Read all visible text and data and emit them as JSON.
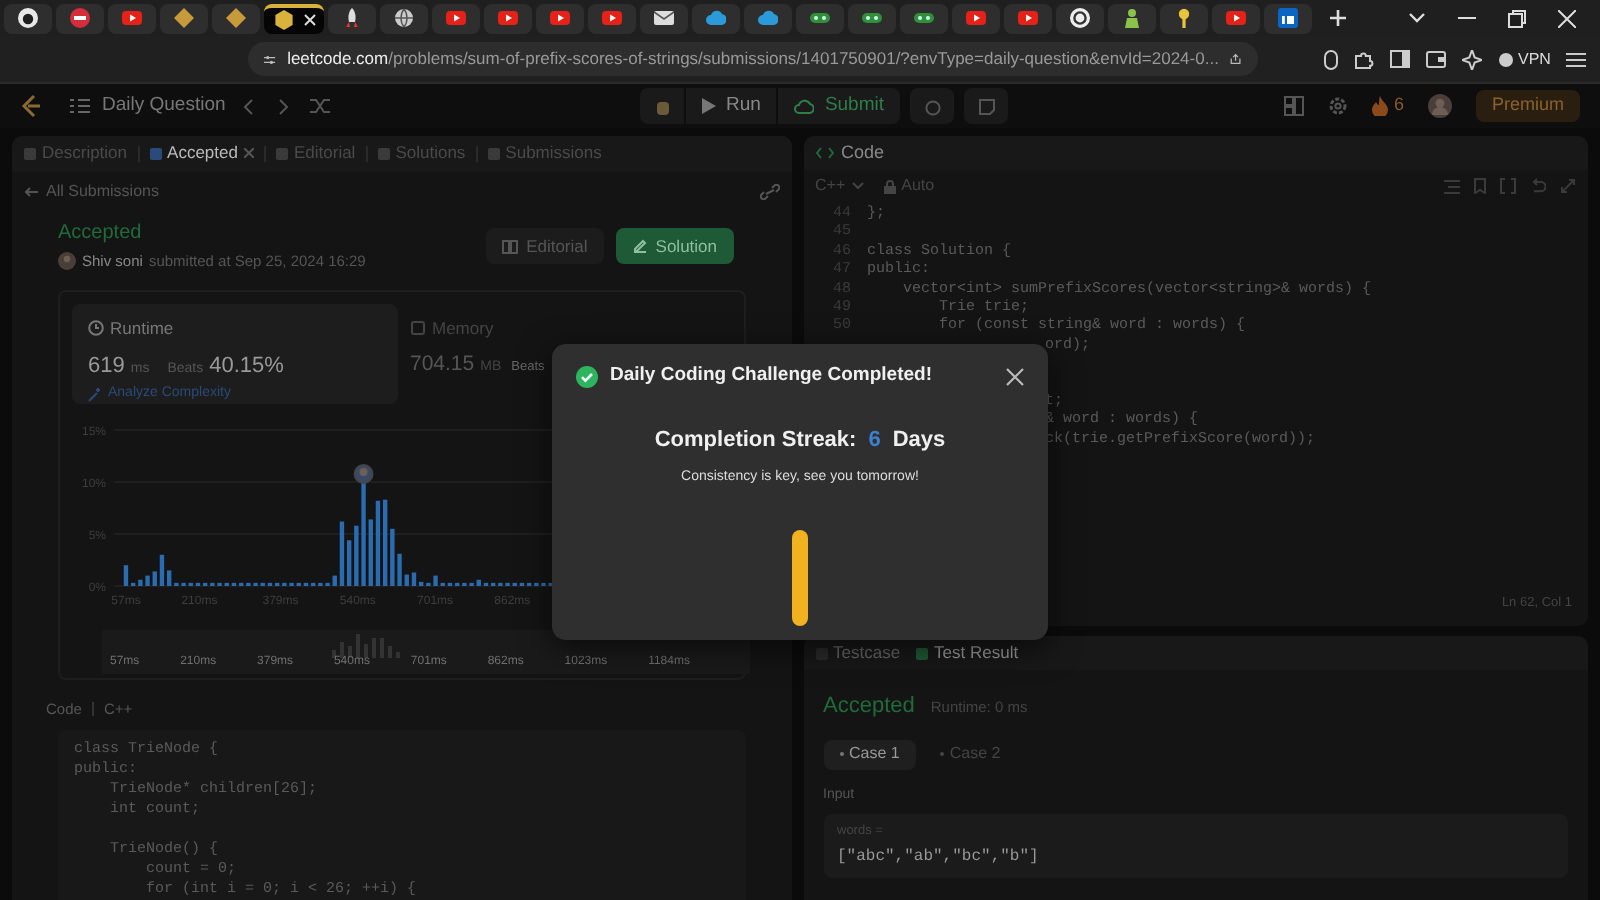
{
  "browser": {
    "tabs": [
      {
        "kind": "github",
        "selected": false
      },
      {
        "kind": "redbadge",
        "selected": false
      },
      {
        "kind": "youtube",
        "selected": false
      },
      {
        "kind": "logo",
        "selected": false
      },
      {
        "kind": "logo",
        "selected": false
      },
      {
        "kind": "letter",
        "selected": true
      },
      {
        "kind": "rocket",
        "selected": false
      },
      {
        "kind": "globe",
        "selected": false
      },
      {
        "kind": "youtube",
        "selected": false
      },
      {
        "kind": "youtube",
        "selected": false
      },
      {
        "kind": "youtube",
        "selected": false
      },
      {
        "kind": "youtube",
        "selected": false
      },
      {
        "kind": "mail",
        "selected": false
      },
      {
        "kind": "cloud",
        "selected": false
      },
      {
        "kind": "cloud",
        "selected": false
      },
      {
        "kind": "gamepad",
        "selected": false
      },
      {
        "kind": "gamepad",
        "selected": false
      },
      {
        "kind": "gamepad",
        "selected": false
      },
      {
        "kind": "youtube",
        "selected": false
      },
      {
        "kind": "youtube",
        "selected": false
      },
      {
        "kind": "circle",
        "selected": false
      },
      {
        "kind": "person",
        "selected": false
      },
      {
        "kind": "key",
        "selected": false
      },
      {
        "kind": "youtube",
        "selected": false
      },
      {
        "kind": "linkedin",
        "selected": false
      }
    ],
    "url_host": "leetcode.com",
    "url_path": "/problems/sum-of-prefix-scores-of-strings/submissions/1401750901/?envType=daily-question&envId=2024-0...",
    "vpn": "VPN"
  },
  "toolbar": {
    "title": "Daily Question",
    "run": "Run",
    "submit": "Submit",
    "streak": "6",
    "premium": "Premium"
  },
  "left_panel": {
    "tabs": [
      {
        "label": "Description",
        "selected": false,
        "closable": false
      },
      {
        "label": "Accepted",
        "selected": true,
        "closable": true
      },
      {
        "label": "Editorial",
        "selected": false,
        "closable": false
      },
      {
        "label": "Solutions",
        "selected": false,
        "closable": false
      },
      {
        "label": "Submissions",
        "selected": false,
        "closable": false
      }
    ],
    "back_link": "All Submissions",
    "status": "Accepted",
    "author": "Shiv soni",
    "submitted": "submitted at Sep 25, 2024 16:29",
    "buttons": [
      {
        "label": "Editorial",
        "kind": "plain"
      },
      {
        "label": "Solution",
        "kind": "primary"
      }
    ],
    "runtime": {
      "title": "Runtime",
      "value": "619",
      "unit": "ms",
      "beats_label": "Beats",
      "beats": "40.15%",
      "link": "Analyze Complexity"
    },
    "memory": {
      "title": "Memory",
      "value": "704.15",
      "unit": "MB",
      "beats_label": "Beats"
    },
    "chart_data": {
      "type": "bar",
      "x": [
        57,
        72,
        87,
        102,
        117,
        132,
        147,
        162,
        177,
        192,
        207,
        222,
        237,
        252,
        267,
        282,
        297,
        312,
        327,
        342,
        357,
        372,
        387,
        402,
        417,
        432,
        447,
        462,
        477,
        492,
        507,
        522,
        537,
        552,
        567,
        582,
        597,
        612,
        627,
        642,
        657,
        672,
        687,
        702,
        717,
        732,
        747,
        762,
        777,
        792,
        807,
        822,
        837,
        852,
        867,
        882,
        897,
        912,
        927,
        942
      ],
      "series": [
        {
          "color": "#2b6cb0",
          "values": [
            2.0,
            0.3,
            0.6,
            1.0,
            1.4,
            3.0,
            1.5,
            0.3,
            0.3,
            0.3,
            0.3,
            0.3,
            0.3,
            0.3,
            0.3,
            0.3,
            0.3,
            0.3,
            0.3,
            0.3,
            0.3,
            0.3,
            0.3,
            0.3,
            0.3,
            0.3,
            0.3,
            0.3,
            0.3,
            1.0,
            6.2,
            4.4,
            5.8,
            10.0,
            6.4,
            8.2,
            8.3,
            5.5,
            3.1,
            1.1,
            1.3,
            0.4,
            0.3,
            1.0,
            0.3,
            0.3,
            0.3,
            0.3,
            0.3,
            0.6,
            0.3,
            0.3,
            0.3,
            0.3,
            0.3,
            0.3,
            0.3,
            0.3,
            0.3,
            0.3
          ]
        }
      ],
      "xlim": [
        50,
        965
      ],
      "ylim": [
        0,
        15
      ],
      "yticks": [
        {
          "value": 0,
          "label": "0%"
        },
        {
          "value": 5,
          "label": "5%"
        },
        {
          "value": 10,
          "label": "10%"
        },
        {
          "value": 15,
          "label": "15%"
        }
      ],
      "xticks": [
        {
          "value": 57,
          "label": "57ms"
        },
        {
          "value": 210,
          "label": "210ms"
        },
        {
          "value": 379,
          "label": "379ms"
        },
        {
          "value": 540,
          "label": "540ms"
        },
        {
          "value": 701,
          "label": "701ms"
        },
        {
          "value": 862,
          "label": "862ms"
        }
      ]
    },
    "brush_labels": [
      "57ms",
      "210ms",
      "379ms",
      "540ms",
      "701ms",
      "862ms",
      "1023ms",
      "1184ms"
    ],
    "code": {
      "label": "Code",
      "language": "C++",
      "lines": [
        {
          "text": "class TrieNode {"
        },
        {
          "text": "public:"
        },
        {
          "text": "    TrieNode* children[26];"
        },
        {
          "text": "    int count;"
        },
        {
          "kind": "blank"
        },
        {
          "text": "    TrieNode() {"
        },
        {
          "text": "        count = 0;"
        },
        {
          "text": "        for (int i = 0; i < 26; ++i) {"
        }
      ]
    }
  },
  "editor": {
    "title": "Code",
    "language": "C++",
    "mode": "Auto",
    "lines": [
      {
        "number": "44",
        "text": "};",
        "kind": "full"
      },
      {
        "number": "45",
        "kind": "full"
      },
      {
        "number": "46",
        "text": "class Solution {",
        "kind": "full"
      },
      {
        "number": "47",
        "text": "public:",
        "kind": "full"
      },
      {
        "number": "48",
        "text": "    vector<int> sumPrefixScores(vector<string>& words) {",
        "kind": "full"
      },
      {
        "number": "49",
        "text": "        Trie trie;",
        "kind": "full"
      },
      {
        "number": "50",
        "text": "        for (const string& word : words) {",
        "kind": "full"
      },
      {
        "text": "ord);",
        "kind": "partial"
      },
      {
        "kind": "hidden"
      },
      {
        "kind": "hidden"
      },
      {
        "text": "t;",
        "kind": "partial"
      },
      {
        "text": "& word : words) {",
        "kind": "partial"
      },
      {
        "text": "ck(trie.getPrefixScore(word));",
        "kind": "partial"
      }
    ],
    "cursor": "Ln 62, Col 1"
  },
  "test_result": {
    "tabs": [
      {
        "label": "Testcase",
        "selected": false
      },
      {
        "label": "Test Result",
        "selected": true
      }
    ],
    "status": "Accepted",
    "runtime": "Runtime: 0 ms",
    "cases": [
      {
        "label": "Case 1",
        "selected": true
      },
      {
        "label": "Case 2",
        "selected": false
      }
    ],
    "input_label": "Input",
    "param": "words =",
    "value": "[\"abc\",\"ab\",\"bc\",\"b\"]"
  },
  "modal": {
    "title": "Daily Coding Challenge Completed!",
    "streak_label": "Completion Streak:",
    "streak": "6",
    "streak_unit": "Days",
    "message": "Consistency is key, see you tomorrow!"
  }
}
